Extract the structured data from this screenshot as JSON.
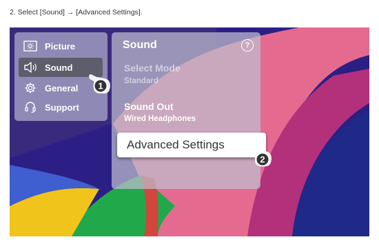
{
  "instruction": "2. Select [Sound] → [Advanced Settings].",
  "side_menu": {
    "items": [
      {
        "label": "Picture",
        "icon": "picture-icon"
      },
      {
        "label": "Sound",
        "icon": "speaker-icon",
        "selected": true
      },
      {
        "label": "General",
        "icon": "gear-icon"
      },
      {
        "label": "Support",
        "icon": "headset-icon"
      }
    ]
  },
  "sound_panel": {
    "title": "Sound",
    "help_label": "?",
    "select_mode": {
      "label": "Select Mode",
      "value": "Standard",
      "enabled": false
    },
    "sound_out": {
      "label": "Sound Out",
      "value": "Wired Headphones"
    },
    "advanced_settings": "Advanced Settings"
  },
  "callouts": [
    "1",
    "2"
  ],
  "colors": {
    "background": "#2b1f86",
    "selected_item": "#5e5d6b",
    "highlight": "#ffffff"
  }
}
